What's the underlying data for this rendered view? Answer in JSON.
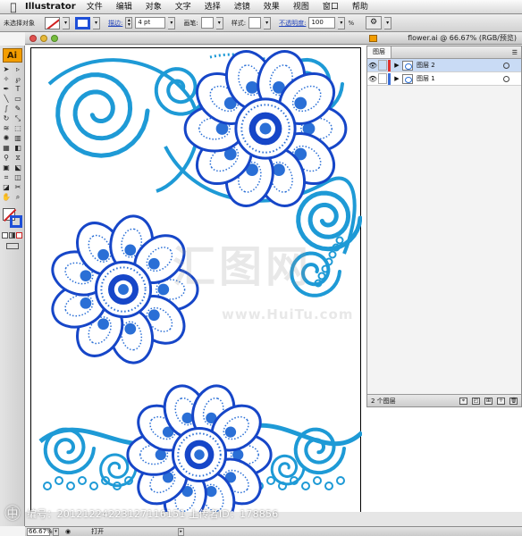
{
  "menubar": {
    "app_name": "Illustrator",
    "items": [
      "文件",
      "编辑",
      "对象",
      "文字",
      "选择",
      "滤镜",
      "效果",
      "视图",
      "窗口",
      "帮助"
    ]
  },
  "controlbar": {
    "selection_status": "未选择对象",
    "stroke_link": "描边:",
    "stroke_weight": "4 pt",
    "brush_label": "画笔:",
    "style_label": "样式:",
    "opacity_link": "不透明度:",
    "opacity_value": "100",
    "opacity_unit": "%"
  },
  "toolbox": {
    "logo": "Ai",
    "tools": [
      {
        "icon": "selection-arrow-icon",
        "glyph": "➤"
      },
      {
        "icon": "direct-selection-icon",
        "glyph": "▹"
      },
      {
        "icon": "magic-wand-icon",
        "glyph": "✧"
      },
      {
        "icon": "lasso-icon",
        "glyph": "℘"
      },
      {
        "icon": "pen-icon",
        "glyph": "✒"
      },
      {
        "icon": "type-icon",
        "glyph": "T"
      },
      {
        "icon": "line-icon",
        "glyph": "╲"
      },
      {
        "icon": "rectangle-icon",
        "glyph": "▭"
      },
      {
        "icon": "paintbrush-icon",
        "glyph": "∫"
      },
      {
        "icon": "pencil-icon",
        "glyph": "✎"
      },
      {
        "icon": "rotate-icon",
        "glyph": "↻"
      },
      {
        "icon": "scale-icon",
        "glyph": "⤡"
      },
      {
        "icon": "warp-icon",
        "glyph": "≋"
      },
      {
        "icon": "free-transform-icon",
        "glyph": "⬚"
      },
      {
        "icon": "symbol-sprayer-icon",
        "glyph": "✺"
      },
      {
        "icon": "column-graph-icon",
        "glyph": "▥"
      },
      {
        "icon": "mesh-icon",
        "glyph": "▦"
      },
      {
        "icon": "gradient-icon",
        "glyph": "◧"
      },
      {
        "icon": "eyedropper-icon",
        "glyph": "⚲"
      },
      {
        "icon": "blend-icon",
        "glyph": "⧖"
      },
      {
        "icon": "live-paint-icon",
        "glyph": "▣"
      },
      {
        "icon": "live-paint-select-icon",
        "glyph": "⬕"
      },
      {
        "icon": "crop-area-icon",
        "glyph": "⌗"
      },
      {
        "icon": "slice-icon",
        "glyph": "◫"
      },
      {
        "icon": "eraser-icon",
        "glyph": "◪"
      },
      {
        "icon": "scissors-icon",
        "glyph": "✂"
      },
      {
        "icon": "hand-icon",
        "glyph": "✋"
      },
      {
        "icon": "zoom-icon",
        "glyph": "⌕"
      }
    ]
  },
  "document": {
    "title": "flower.ai @ 66.67% (RGB/预览)"
  },
  "layers_panel": {
    "tab": "图层",
    "layers": [
      {
        "name": "图层 2",
        "color": "#e03131",
        "active": true
      },
      {
        "name": "图层 1",
        "color": "#3b6fd9",
        "active": false
      }
    ],
    "footer_count": "2 个图层"
  },
  "statusbar": {
    "zoom": "66.67%",
    "status_text": "打开"
  },
  "watermark": {
    "logo_text": "汇图网",
    "site": "www.HuiTu.com",
    "id_text": "编号：20121224223127116151 上传者ID：178856"
  },
  "colors": {
    "light_blue": "#1e9ad6",
    "dark_blue": "#1646c8",
    "royal_blue": "#2a6fd6"
  }
}
